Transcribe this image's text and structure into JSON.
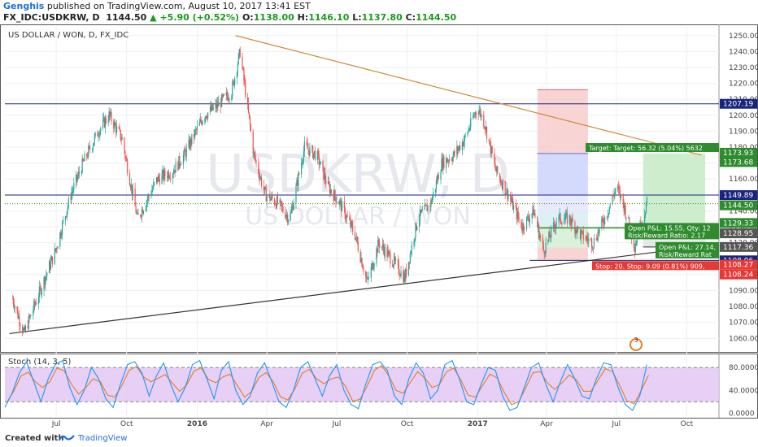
{
  "header": {
    "author": "Genghis",
    "published_text": "published on TradingView.com, August 10, 2017 13:41 EST",
    "symbol": "FX_IDC:USDKRW, D",
    "last": "1144.50",
    "change": "▲ +5.90 (+0.52%)",
    "o_label": "O:",
    "o": "1138.00",
    "h_label": "H:",
    "h": "1146.10",
    "l_label": "L:",
    "l": "1137.80",
    "c_label": "C:",
    "c": "1144.50"
  },
  "footer": {
    "created_with": "Created with",
    "brand": "TradingView"
  },
  "colors": {
    "up": "#26a69a",
    "down": "#ef5350",
    "hline": "#1a237e",
    "trend": "#d08a3a",
    "support": "#333333",
    "target_zone": "#c8ebc8",
    "stop_zone": "#f6c9c9",
    "stoch_band": "#e3c7f5",
    "stoch_k": "#2196f3",
    "stoch_d": "#e67e22"
  },
  "chart_data": [
    {
      "type": "candlestick",
      "title": "US DOLLAR / WON, D, FX_IDC",
      "watermark_symbol": "USDKRW, D",
      "watermark_name": "US DOLLAR / WON",
      "x_tick_labels": [
        "Jul",
        "Oct",
        "2016",
        "Apr",
        "Jul",
        "Oct",
        "2017",
        "Apr",
        "Jul",
        "Oct"
      ],
      "y_ticks": [
        1060,
        1070,
        1080,
        1090,
        1100,
        1110,
        1120,
        1130,
        1140,
        1150,
        1160,
        1170,
        1180,
        1190,
        1200,
        1210,
        1220,
        1230,
        1240,
        1250
      ],
      "y_tick_labels": [
        "1060.00",
        "1070.00",
        "1080.00",
        "1090.00",
        "1100.00",
        "1110.00",
        "1120.00",
        "1130.00",
        "1140.00",
        "1150.00",
        "1160.00",
        "1170.00",
        "1180.00",
        "1190.00",
        "1200.00",
        "1210.00",
        "1220.00",
        "1230.00",
        "1240.00",
        "1250.00"
      ],
      "ylim": [
        1052,
        1256
      ],
      "close_path": [
        [
          "2015-05-05",
          1085
        ],
        [
          "2015-05-20",
          1063
        ],
        [
          "2015-06-10",
          1090
        ],
        [
          "2015-06-30",
          1115
        ],
        [
          "2015-07-20",
          1150
        ],
        [
          "2015-08-05",
          1170
        ],
        [
          "2015-08-25",
          1190
        ],
        [
          "2015-09-08",
          1200
        ],
        [
          "2015-09-25",
          1185
        ],
        [
          "2015-10-15",
          1135
        ],
        [
          "2015-11-10",
          1160
        ],
        [
          "2015-11-30",
          1165
        ],
        [
          "2015-12-15",
          1175
        ],
        [
          "2016-01-10",
          1200
        ],
        [
          "2016-01-25",
          1205
        ],
        [
          "2016-02-15",
          1215
        ],
        [
          "2016-02-26",
          1240
        ],
        [
          "2016-03-15",
          1175
        ],
        [
          "2016-03-30",
          1150
        ],
        [
          "2016-04-15",
          1145
        ],
        [
          "2016-05-01",
          1135
        ],
        [
          "2016-05-20",
          1180
        ],
        [
          "2016-06-05",
          1175
        ],
        [
          "2016-06-20",
          1155
        ],
        [
          "2016-07-05",
          1145
        ],
        [
          "2016-07-25",
          1125
        ],
        [
          "2016-08-10",
          1095
        ],
        [
          "2016-08-25",
          1120
        ],
        [
          "2016-09-10",
          1110
        ],
        [
          "2016-09-28",
          1098
        ],
        [
          "2016-10-15",
          1135
        ],
        [
          "2016-11-01",
          1145
        ],
        [
          "2016-11-15",
          1170
        ],
        [
          "2016-12-01",
          1175
        ],
        [
          "2016-12-15",
          1185
        ],
        [
          "2017-01-01",
          1205
        ],
        [
          "2017-01-10",
          1195
        ],
        [
          "2017-01-25",
          1165
        ],
        [
          "2017-02-10",
          1150
        ],
        [
          "2017-02-28",
          1130
        ],
        [
          "2017-03-15",
          1140
        ],
        [
          "2017-03-28",
          1115
        ],
        [
          "2017-04-15",
          1135
        ],
        [
          "2017-05-01",
          1135
        ],
        [
          "2017-05-15",
          1125
        ],
        [
          "2017-06-01",
          1120
        ],
        [
          "2017-06-20",
          1140
        ],
        [
          "2017-07-01",
          1155
        ],
        [
          "2017-07-10",
          1145
        ],
        [
          "2017-07-25",
          1118
        ],
        [
          "2017-08-10",
          1145
        ]
      ],
      "horizontal_lines": [
        {
          "value": 1207.19,
          "label": "1207.19"
        },
        {
          "value": 1149.89,
          "label": "1149.89"
        },
        {
          "value": 1108.96,
          "label": "1108.96"
        }
      ],
      "price_labels": [
        {
          "value": 1173.93,
          "label": "1173.93",
          "color": "#2e8b2e"
        },
        {
          "value": 1173.68,
          "label": "1173.68",
          "color": "#2e8b2e"
        },
        {
          "value": 1144.5,
          "label": "1144.50",
          "color": "#2e8b2e"
        },
        {
          "value": 1129.33,
          "label": "1129.33",
          "color": "#2e8b2e"
        },
        {
          "value": 1128.95,
          "label": "1128.95",
          "color": "#555555"
        },
        {
          "value": 1117.36,
          "label": "1117.36",
          "color": "#555555"
        },
        {
          "value": 1108.27,
          "label": "1108.27",
          "color": "#e53935"
        },
        {
          "value": 1108.24,
          "label": "1108.24",
          "color": "#e53935"
        }
      ],
      "trendlines": [
        {
          "from": [
            "2016-02-20",
            1250
          ],
          "to": [
            "2017-10-20",
            1175
          ],
          "color": "#d08a3a"
        },
        {
          "from": [
            "2015-05-01",
            1063
          ],
          "to": [
            "2017-10-25",
            1118
          ],
          "color": "#333333"
        }
      ],
      "positions": [
        {
          "from": "2017-03-20",
          "to": "2017-05-25",
          "entry": 1149.89,
          "target": 1176,
          "stop": 1117,
          "color": "#6f8fe8"
        },
        {
          "from": "2017-03-20",
          "to": "2017-05-25",
          "entry": 1129.33,
          "target": 1216,
          "stop": 1108.96,
          "color": "#e88f8f"
        },
        {
          "from": "2017-08-05",
          "to": "2017-10-25",
          "entry": 1129.33,
          "target": 1176,
          "stop": 1108.24,
          "color": "#7fcf7f"
        }
      ],
      "annotations": {
        "target": "Target:  Target: 56.32 (5.04%) 5632",
        "open_pl_1": "Open P&L: 15.55, Qty: 12",
        "rr_1": "Risk/Reward Ratio: 2.17",
        "open_pl_2": "Open P&L: 27.14,",
        "rr_2": "Risk/Reward Rat",
        "stop": "Stop: 20.  Stop: 9.09 (0.81%) 909,"
      },
      "events_badge": "3"
    },
    {
      "type": "line",
      "title": "Stoch (14, 3, 5)",
      "ylim": [
        -5,
        100
      ],
      "y_ticks": [
        0,
        40,
        80
      ],
      "y_tick_labels": [
        "0.0000",
        "40.0000",
        "80.0000"
      ],
      "band": [
        20,
        80
      ],
      "k_path": [
        10,
        35,
        70,
        90,
        55,
        20,
        60,
        85,
        92,
        45,
        15,
        40,
        80,
        60,
        25,
        10,
        50,
        85,
        90,
        70,
        30,
        65,
        88,
        50,
        20,
        45,
        85,
        92,
        60,
        25,
        75,
        90,
        40,
        15,
        30,
        70,
        88,
        55,
        20,
        10,
        40,
        80,
        90,
        60,
        30,
        65,
        85,
        40,
        15,
        8,
        50,
        85,
        90,
        75,
        30,
        15,
        60,
        88,
        70,
        25,
        40,
        85,
        92,
        60,
        20,
        15,
        50,
        80,
        75,
        30,
        5,
        10,
        45,
        80,
        88,
        50,
        20,
        55,
        85,
        60,
        30,
        25,
        60,
        88,
        85,
        45,
        15,
        5,
        30,
        85
      ]
    }
  ]
}
